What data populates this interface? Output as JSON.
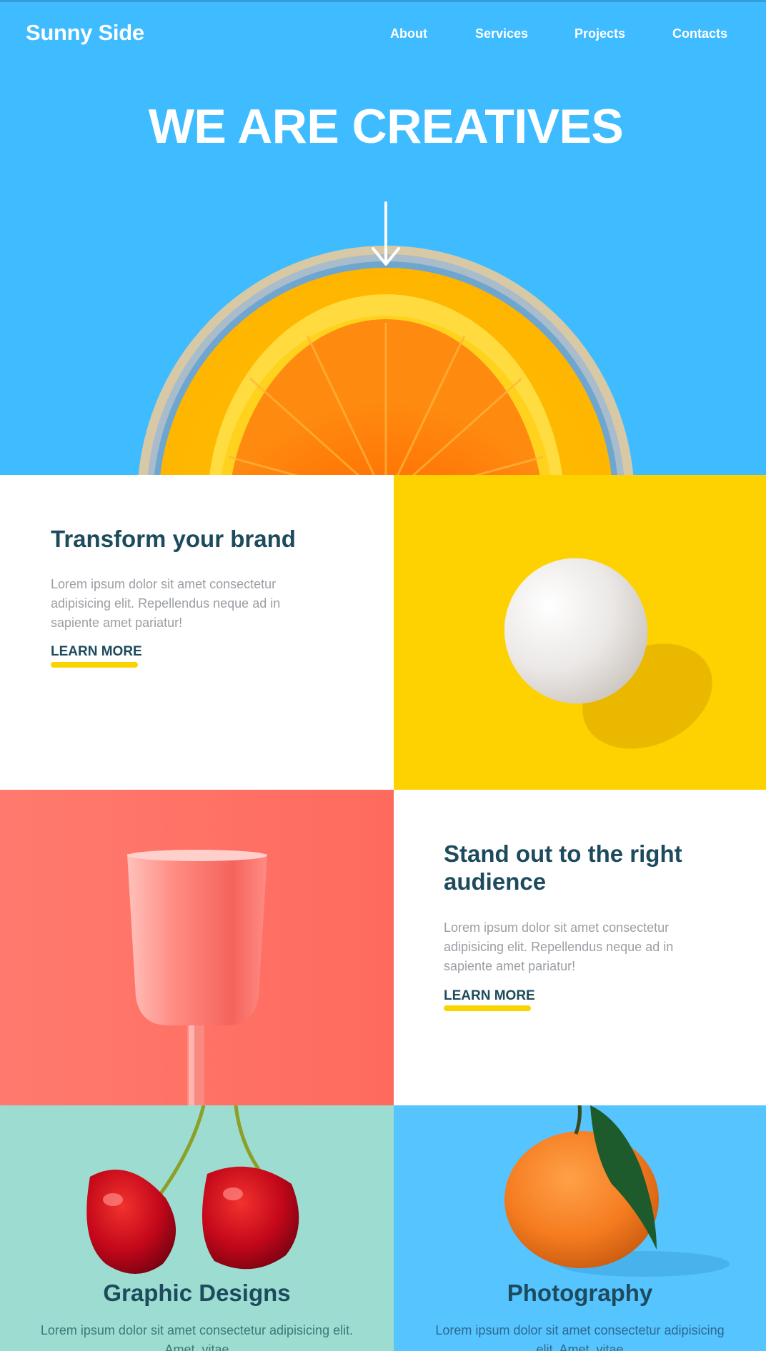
{
  "header": {
    "logo": "Sunny Side",
    "nav": [
      {
        "label": "About"
      },
      {
        "label": "Services"
      },
      {
        "label": "Projects"
      },
      {
        "label": "Contacts"
      }
    ]
  },
  "hero": {
    "title": "WE ARE CREATIVES",
    "scroll_icon": "arrow-down-icon"
  },
  "sections": {
    "transform": {
      "heading": "Transform your brand",
      "body": "Lorem ipsum dolor sit amet consectetur adipisicing elit. Repellendus neque ad in sapiente amet pariatur!",
      "link": "LEARN MORE"
    },
    "standout": {
      "heading": "Stand out to the right audience",
      "body": "Lorem ipsum dolor sit amet consectetur adipisicing elit. Repellendus neque ad in sapiente amet pariatur!",
      "link": "LEARN MORE"
    }
  },
  "tiles": {
    "graphic": {
      "title": "Graphic Designs",
      "text": "Lorem ipsum dolor sit amet consectetur adipisicing elit. Amet, vitae"
    },
    "photo": {
      "title": "Photography",
      "text": "Lorem ipsum dolor sit amet consectetur adipisicing elit. Amet, vitae"
    }
  },
  "colors": {
    "hero_blue": "#3fbbff",
    "heading_navy": "#1d4b5d",
    "accent_yellow": "#fad400",
    "coral": "#ff7367",
    "mint": "#9ddcd0",
    "sky": "#56c4ff"
  }
}
